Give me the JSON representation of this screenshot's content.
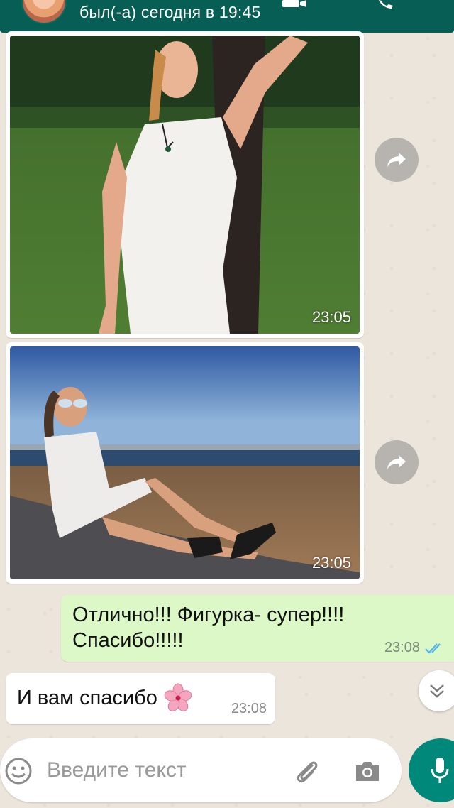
{
  "header": {
    "status": "был(-а) сегодня в 19:45"
  },
  "messages": [
    {
      "type": "image",
      "direction": "incoming",
      "time": "23:05"
    },
    {
      "type": "image",
      "direction": "incoming",
      "time": "23:05"
    },
    {
      "type": "text",
      "direction": "outgoing",
      "text": "Отлично!!! Фигурка- супер!!!! Спасибо!!!!!",
      "time": "23:08",
      "status": "read"
    },
    {
      "type": "text",
      "direction": "incoming",
      "text": "И вам спасибо",
      "emoji": "sakura-flower",
      "time": "23:08"
    }
  ],
  "composer": {
    "placeholder": "Введите текст"
  },
  "colors": {
    "header": "#075e54",
    "outgoing_bubble": "#dcf8c6",
    "incoming_bubble": "#ffffff",
    "accent": "#00897b",
    "read_ticks": "#4fb6ec"
  },
  "icons": [
    "video-call-icon",
    "phone-icon",
    "forward-icon",
    "double-check-icon",
    "chevrons-down-icon",
    "emoji-icon",
    "attach-icon",
    "camera-icon",
    "mic-icon",
    "sakura-flower-icon"
  ]
}
